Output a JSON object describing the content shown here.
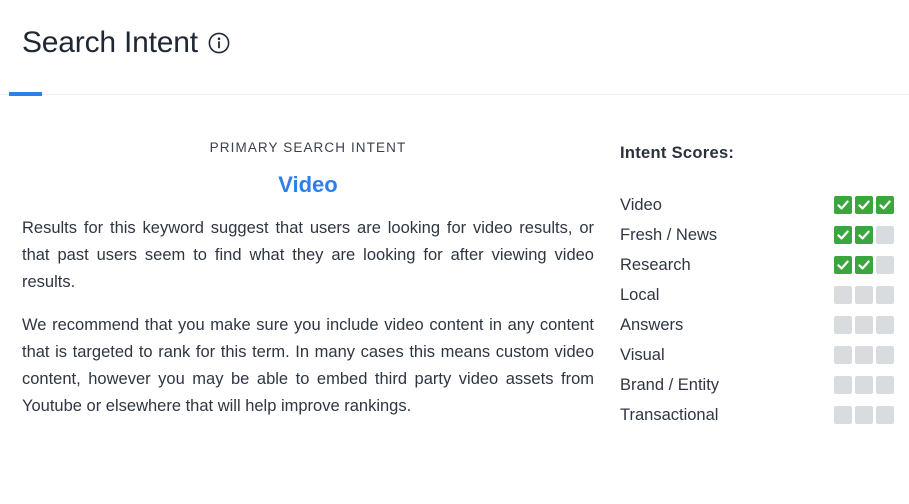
{
  "header": {
    "title": "Search Intent",
    "info_icon": "info-circle-icon",
    "accent_color": "#2f7fe9"
  },
  "primary": {
    "kicker": "PRIMARY SEARCH INTENT",
    "intent": "Video",
    "paragraph_1": "Results for this keyword suggest that users are looking for video results, or that past users seem to find what they are looking for after viewing video results.",
    "paragraph_2": "We recommend that you make sure you include video content in any content that is targeted to rank for this term. In many cases this means custom video content, however you may be able to embed third party video assets from Youtube or elsewhere that will help improve rankings."
  },
  "scores": {
    "title": "Intent Scores:",
    "max": 3,
    "on_color": "#3aa63e",
    "off_color": "#d9dcdf",
    "check_icon": "check-icon",
    "items": [
      {
        "label": "Video",
        "score": 3
      },
      {
        "label": "Fresh / News",
        "score": 2
      },
      {
        "label": "Research",
        "score": 2
      },
      {
        "label": "Local",
        "score": 0
      },
      {
        "label": "Answers",
        "score": 0
      },
      {
        "label": "Visual",
        "score": 0
      },
      {
        "label": "Brand / Entity",
        "score": 0
      },
      {
        "label": "Transactional",
        "score": 0
      }
    ]
  }
}
